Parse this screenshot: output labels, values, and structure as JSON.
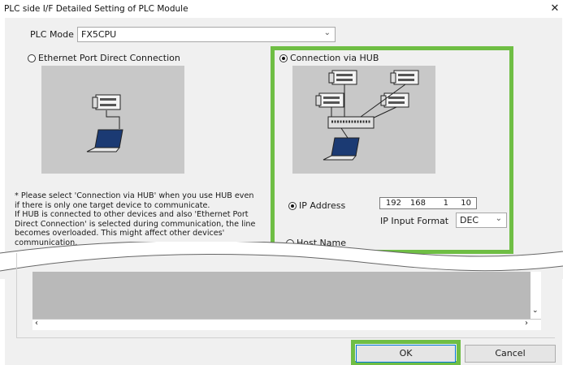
{
  "window": {
    "title": "PLC side I/F Detailed Setting of PLC Module",
    "close_glyph": "✕"
  },
  "plc_mode": {
    "label": "PLC Mode",
    "value": "FX5CPU"
  },
  "options": {
    "direct": {
      "label": "Ethernet Port Direct Connection",
      "selected": false
    },
    "hub": {
      "label": "Connection via HUB",
      "selected": true
    }
  },
  "note_lines": [
    "* Please select 'Connection via HUB' when you use HUB even",
    "if there is only one target device to communicate.",
    "If HUB is connected to other devices and also 'Ethernet Port",
    "Direct Connection' is selected during communication, the line",
    "becomes overloaded. This might affect other devices'",
    "communication."
  ],
  "address": {
    "ip_label": "IP Address",
    "ip_selected": true,
    "ip": [
      "192",
      "168",
      "1",
      "10"
    ],
    "format_label": "IP Input Format",
    "format_value": "DEC",
    "host_label": "Host Name",
    "host_selected": false
  },
  "buttons": {
    "ok": "OK",
    "cancel": "Cancel"
  },
  "colors": {
    "highlight": "#6fbe44",
    "panel": "#c8c8c8",
    "dialog": "#f0f0f0"
  },
  "icons": {
    "dropdown": "chevron-down-icon",
    "scroll_left": "chevron-left-icon",
    "scroll_right": "chevron-right-icon",
    "scroll_down": "chevron-down-icon"
  }
}
